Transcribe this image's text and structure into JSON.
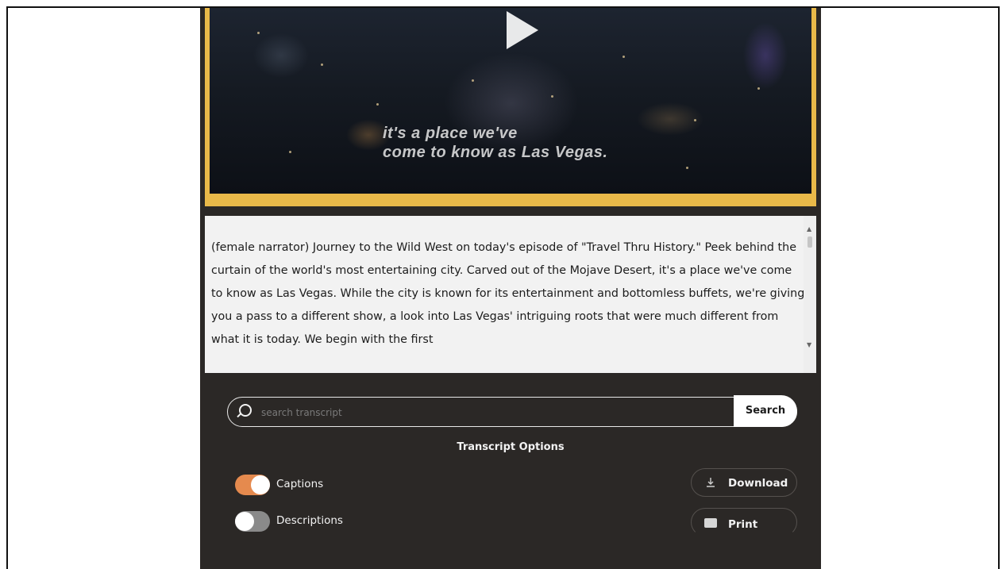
{
  "video": {
    "subtitle_line1": "it's a place we've",
    "subtitle_line2": "come to know as Las Vegas.",
    "play_icon": "play-icon"
  },
  "transcript": {
    "text": "(female narrator) Journey to the Wild West on today's episode of \"Travel Thru History.\" Peek behind the curtain of the world's most entertaining city. Carved out of the Mojave Desert, it's a place we've come to know as Las Vegas. While the city is known for its entertainment and bottomless buffets, we're giving you a pass to a different show, a look into Las Vegas' intriguing roots that were much different from what it is today. We begin with the first"
  },
  "search": {
    "placeholder": "search transcript",
    "button_label": "Search"
  },
  "options": {
    "title": "Transcript Options",
    "captions_label": "Captions",
    "captions_on": true,
    "descriptions_label": "Descriptions",
    "descriptions_on": false,
    "download_label": "Download",
    "print_label": "Print"
  },
  "colors": {
    "accent_border": "#e9b949",
    "toggle_on": "#e58a4e",
    "panel_bg": "#2b2826"
  }
}
